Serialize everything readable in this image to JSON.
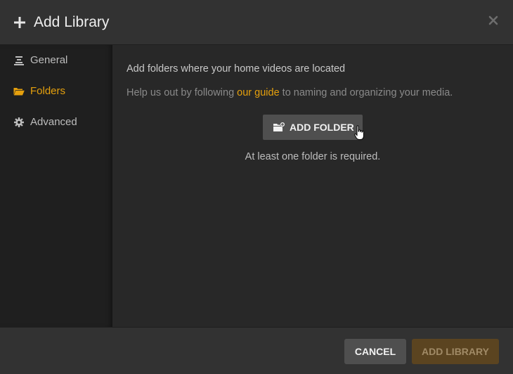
{
  "dialog": {
    "title": "Add Library",
    "icon": "plus-icon",
    "close_icon": "close-icon"
  },
  "sidebar": {
    "items": [
      {
        "label": "General",
        "icon": "general-lines-icon",
        "active": false
      },
      {
        "label": "Folders",
        "icon": "folder-open-icon",
        "active": true
      },
      {
        "label": "Advanced",
        "icon": "gear-icon",
        "active": false
      }
    ]
  },
  "main": {
    "heading": "Add folders where your home videos are located",
    "help_prefix": "Help us out by following ",
    "help_link": "our guide",
    "help_suffix": " to naming and organizing your media.",
    "add_folder_label": "ADD FOLDER",
    "add_folder_icon": "add-folder-icon",
    "required_note": "At least one folder is required."
  },
  "footer": {
    "cancel_label": "CANCEL",
    "add_library_label": "ADD LIBRARY"
  },
  "colors": {
    "accent": "#e5a00d",
    "background": "#282828",
    "header": "#323232",
    "sidebar": "#1f1f1f",
    "button": "#4f4f4f",
    "primary_disabled": "#5b4420"
  }
}
